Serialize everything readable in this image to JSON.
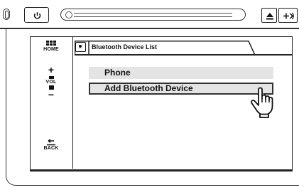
{
  "device": {
    "power_button": "power-icon",
    "eject_button": "eject-icon",
    "source_button": "source-icon"
  },
  "sidebar": {
    "home_label": "HOME",
    "vol_plus": "+",
    "vol_label": "VOL",
    "vol_minus": "−",
    "back_label": "BACK"
  },
  "screen": {
    "tab_icon": "bluetooth-device-icon",
    "title": "Bluetooth Device List",
    "items": [
      {
        "label": "Phone"
      },
      {
        "label": "Add Bluetooth Device"
      }
    ],
    "cursor": "hand-pointer-icon"
  },
  "colors": {
    "item_bg": "#e4e4e4",
    "line": "#222222"
  }
}
